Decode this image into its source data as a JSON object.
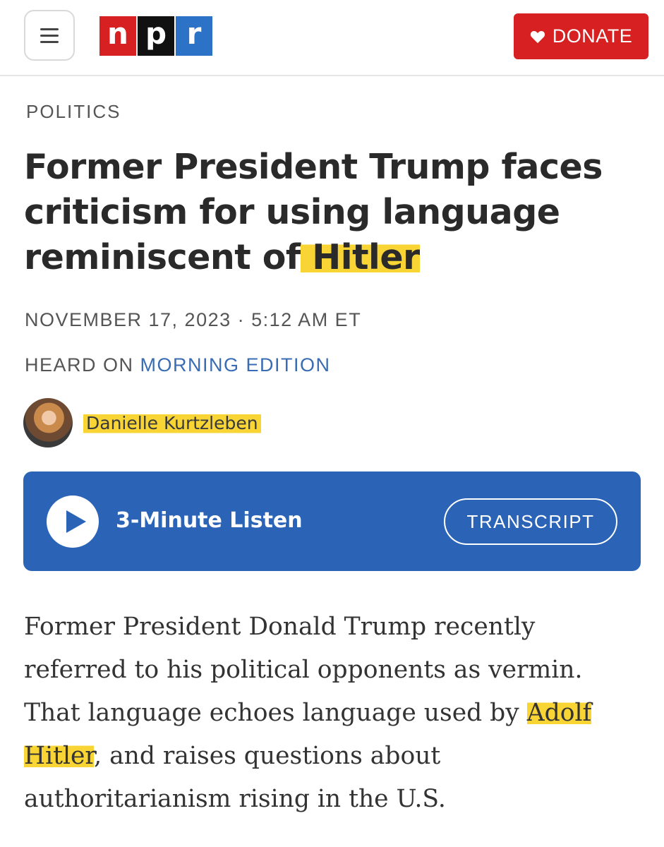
{
  "header": {
    "logo_letters": [
      "n",
      "p",
      "r"
    ],
    "donate_label": "DONATE",
    "colors": {
      "brand_red": "#d62021",
      "brand_black": "#111111",
      "brand_blue": "#2c72c7"
    }
  },
  "article": {
    "section": "POLITICS",
    "headline_part1": "Former President Trump faces criticism for using language reminiscent of",
    "headline_highlight": " Hitler",
    "dateline": "NOVEMBER 17, 2023 · 5:12 AM ET",
    "heard_on_prefix": "HEARD ON ",
    "heard_on_show": "MORNING EDITION",
    "byline": "Danielle Kurtzleben",
    "teaser_part1": "Former President Donald Trump recently referred to his political opponents as vermin. That language echoes language used by ",
    "teaser_highlight": "Adolf Hitler",
    "teaser_part2": ", and raises questions about authoritarianism rising in the U.S."
  },
  "audio": {
    "listen_label": "3-Minute Listen",
    "transcript_label": "TRANSCRIPT",
    "bar_color": "#2b63b6"
  },
  "highlight_color": "#f9d435"
}
